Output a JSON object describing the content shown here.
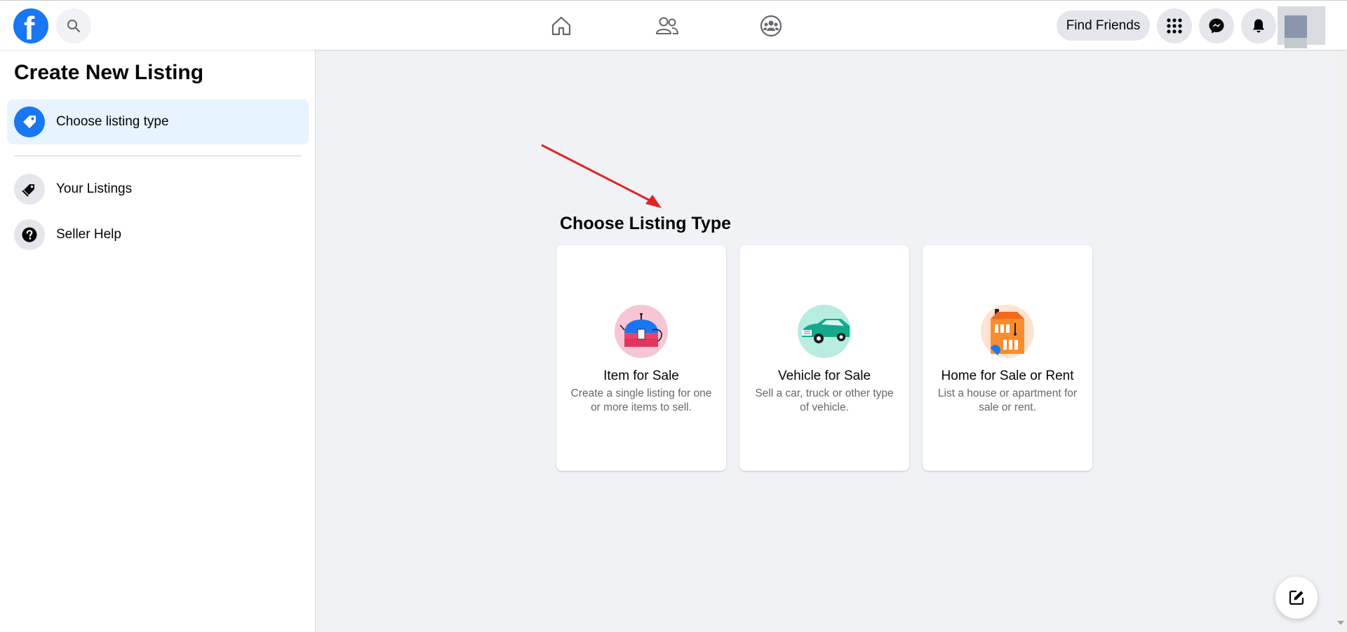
{
  "header": {
    "logo": "f",
    "find_friends_label": "Find Friends",
    "icons": [
      "search-icon",
      "home-icon",
      "friends-icon",
      "groups-icon",
      "menu-grid-icon",
      "messenger-icon",
      "notifications-icon"
    ]
  },
  "sidebar": {
    "title": "Create New Listing",
    "items": [
      {
        "label": "Choose listing type",
        "icon": "tag-icon",
        "active": true
      },
      {
        "label": "Your Listings",
        "icon": "tags-icon",
        "active": false
      },
      {
        "label": "Seller Help",
        "icon": "help-icon",
        "active": false
      }
    ]
  },
  "main": {
    "title": "Choose Listing Type",
    "cards": [
      {
        "title": "Item for Sale",
        "description": "Create a single listing for one or more items to sell.",
        "icon": "item-sale-illustration",
        "bg": "#f7c6d4"
      },
      {
        "title": "Vehicle for Sale",
        "description": "Sell a car, truck or other type of vehicle.",
        "icon": "vehicle-illustration",
        "bg": "#b8ece0"
      },
      {
        "title": "Home for Sale or Rent",
        "description": "List a house or apartment for sale or rent.",
        "icon": "home-illustration",
        "bg": "#fde3d2"
      }
    ]
  },
  "colors": {
    "accent": "#1877f2",
    "annotation_arrow": "#e02424"
  }
}
